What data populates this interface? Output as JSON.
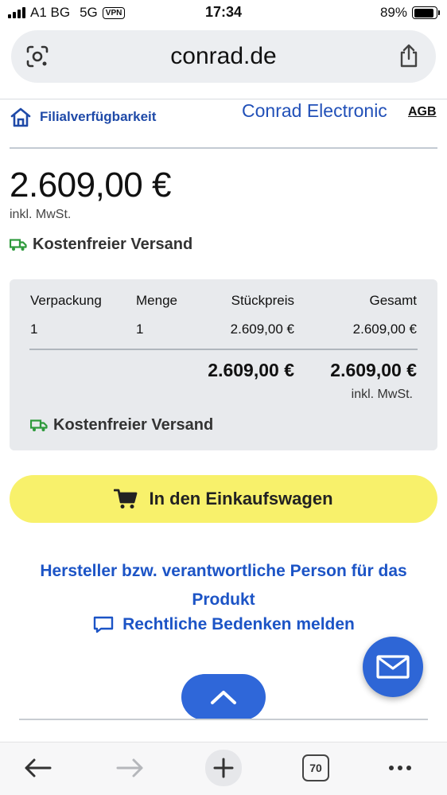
{
  "status_bar": {
    "carrier": "A1 BG",
    "network": "5G",
    "vpn": "VPN",
    "time": "17:34",
    "battery": "89%",
    "battery_level": 0.89
  },
  "browser": {
    "url": "conrad.de",
    "tab_count": "70"
  },
  "header": {
    "store_availability": "Filialverfügbarkeit",
    "brand": "Conrad Electronic",
    "agb": "AGB"
  },
  "product": {
    "price": "2.609,00 €",
    "tax_note": "inkl. MwSt.",
    "shipping": "Kostenfreier Versand"
  },
  "price_table": {
    "columns": [
      "Verpackung",
      "Menge",
      "Stückpreis",
      "Gesamt"
    ],
    "row": [
      "1",
      "1",
      "2.609,00 €",
      "2.609,00 €"
    ],
    "total_unit": "2.609,00 €",
    "total_sum": "2.609,00 €",
    "tax_note": "inkl. MwSt.",
    "shipping": "Kostenfreier Versand"
  },
  "actions": {
    "add_to_cart": "In den Einkaufswagen",
    "manufacturer": "Hersteller bzw. verantwortliche Person für das Produkt",
    "report": "Rechtliche Bedenken melden"
  },
  "colors": {
    "brand_blue": "#2150b8",
    "link_blue": "#1c54c6",
    "cart_yellow": "#f8f16b",
    "shipping_green": "#2e9a3c",
    "fab_blue": "#2e66d6"
  }
}
